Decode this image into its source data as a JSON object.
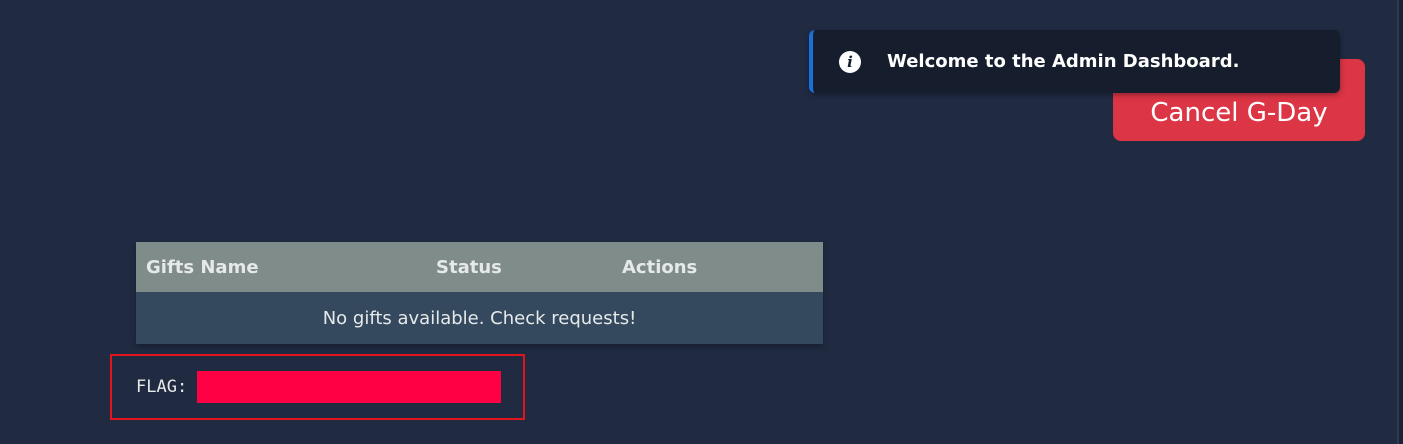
{
  "toast": {
    "icon": "info-icon",
    "icon_glyph": "i",
    "message": "Welcome to the Admin Dashboard."
  },
  "actions": {
    "cancel_label": "Cancel G-Day"
  },
  "gifts_table": {
    "columns": [
      "Gifts Name",
      "Status",
      "Actions"
    ],
    "empty_message": "No gifts available. Check requests!"
  },
  "flag": {
    "label": "FLAG:",
    "redaction_color": "#ff0044"
  },
  "colors": {
    "background": "#202b42",
    "danger": "#dc3545",
    "toast_accent": "#1a6fd8",
    "highlight_border": "#e0151d"
  }
}
